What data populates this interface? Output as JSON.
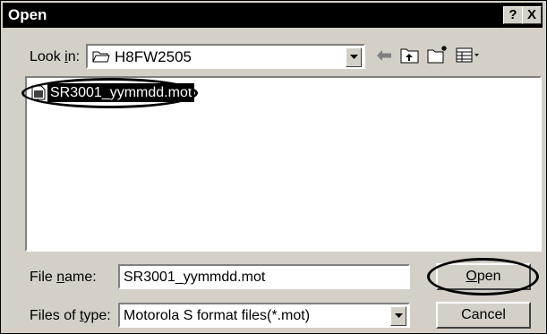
{
  "window": {
    "title": "Open",
    "help_button": "?",
    "close_button": "X"
  },
  "look_in": {
    "label_before": "Look ",
    "label_underlined": "i",
    "label_after": "n:",
    "value": "H8FW2505",
    "folder_icon": "folder-icon"
  },
  "toolbar": {
    "back_icon": "back-arrow-icon",
    "up_icon": "up-folder-icon",
    "new_folder_icon": "new-folder-icon",
    "view_menu_icon": "view-menu-icon"
  },
  "file_list": {
    "items": [
      {
        "name": "SR3001_yymmdd.mot",
        "icon": "file-icon",
        "selected": true
      }
    ]
  },
  "file_name": {
    "label_before": "File ",
    "label_underlined": "n",
    "label_after": "ame:",
    "value": "SR3001_yymmdd.mot"
  },
  "file_type": {
    "label_before": "Files of ",
    "label_underlined": "t",
    "label_after": "ype:",
    "value": "Motorola S format files(*.mot)"
  },
  "buttons": {
    "open_underlined": "O",
    "open_rest": "pen",
    "cancel": "Cancel"
  },
  "colors": {
    "dialog_bg": "#d4d0c8",
    "title_bar": "#000000",
    "selection": "#000000"
  }
}
